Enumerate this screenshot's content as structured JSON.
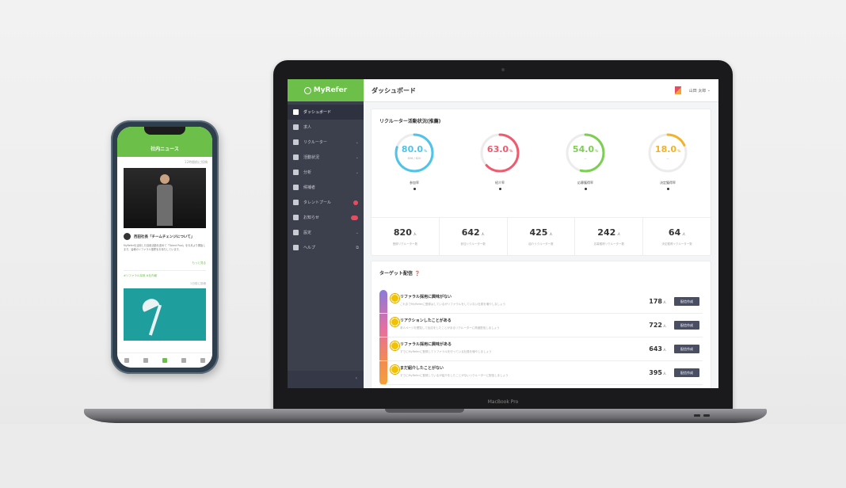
{
  "laptop": {
    "brand": "MacBook Pro",
    "app": {
      "logo": "MyRefer",
      "page_title": "ダッシュボード",
      "user": "山田 太郎",
      "nav": [
        {
          "label": "ダッシュボード",
          "active": true
        },
        {
          "label": "求人"
        },
        {
          "label": "リクルーター"
        },
        {
          "label": "活動状況"
        },
        {
          "label": "分析"
        },
        {
          "label": "候補者"
        },
        {
          "label": "タレントプール"
        },
        {
          "label": "お知らせ"
        },
        {
          "label": "設定"
        },
        {
          "label": "ヘルプ"
        }
      ],
      "activity": {
        "title": "リクルーター活動状況(推薦)",
        "donuts": [
          {
            "value": "80.0",
            "unit": "%",
            "sub": "656 / 820",
            "label": "参加率",
            "color": "#4fc3e8",
            "fraction": 0.8
          },
          {
            "value": "63.0",
            "unit": "%",
            "sub": "—",
            "label": "紹介率",
            "color": "#ef5a6f",
            "fraction": 0.63
          },
          {
            "value": "54.0",
            "unit": "%",
            "sub": "—",
            "label": "応募獲得率",
            "color": "#7ccf52",
            "fraction": 0.54
          },
          {
            "value": "18.0",
            "unit": "%",
            "sub": "—",
            "label": "決定獲得率",
            "color": "#f2b22a",
            "fraction": 0.18
          }
        ],
        "stats": [
          {
            "value": "820",
            "unit": "人",
            "label": "登録リクルーター数"
          },
          {
            "value": "642",
            "unit": "人",
            "label": "参加リクルーター数"
          },
          {
            "value": "425",
            "unit": "人",
            "label": "紹介リクルーター数"
          },
          {
            "value": "242",
            "unit": "人",
            "label": "応募獲得リクルーター数"
          },
          {
            "value": "64",
            "unit": "人",
            "label": "決定獲得リクルーター数"
          }
        ]
      },
      "target": {
        "title": "ターゲット配信",
        "rows": [
          {
            "title": "リファラル採用に興味がない",
            "desc": "これまでMyReferに登録はしているがリファラルをしていない社員を増やしましょう",
            "count": "178",
            "unit": "人",
            "button": "配信作成"
          },
          {
            "title": "リアクションしたことがある",
            "desc": "求人ページを閲覧して反応をしたことがあるリクルーターに再度配信しましょう",
            "count": "722",
            "unit": "人",
            "button": "配信作成"
          },
          {
            "title": "リファラル採用に興味がある",
            "desc": "すでにMyReferに登録してリファラルを行っている社員を増やしましょう",
            "count": "643",
            "unit": "人",
            "button": "配信作成"
          },
          {
            "title": "まだ紹介したことがない",
            "desc": "すでにMyReferに登録しているが紹介をしたことがないリクルーターに配信しましょう",
            "count": "395",
            "unit": "人",
            "button": "配信作成"
          }
        ]
      }
    }
  },
  "phone": {
    "header": "社内ニュース",
    "meta": "12時間前に投稿",
    "post": {
      "title": "西田社長「チームチェンジについて」",
      "body": "MyReferを活用した採用活動を進めて「Talent Pool」を今月より開始します。皆様のリファラル推薦をお待ちしています。",
      "more": "もっと見る",
      "tags": "#リファラル採用 #社内報"
    },
    "meta2": "2日前に投稿"
  }
}
